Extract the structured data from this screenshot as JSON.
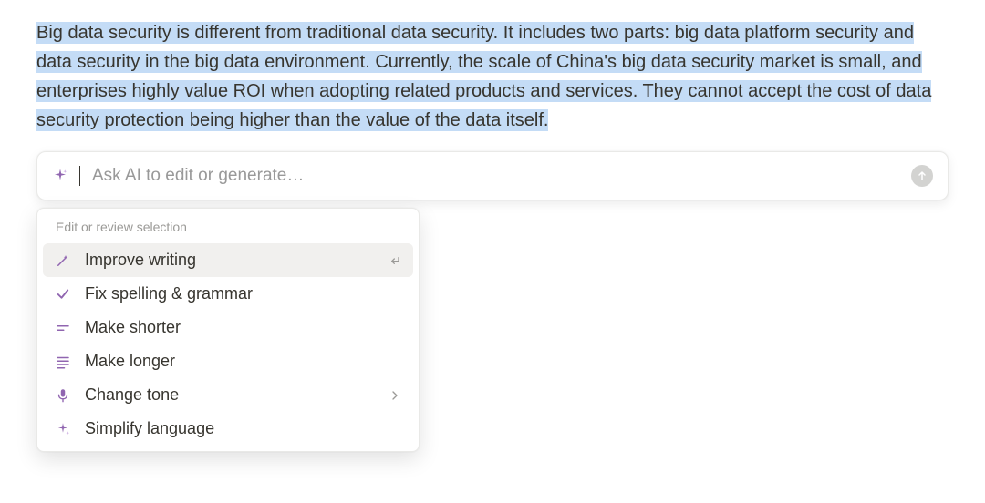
{
  "selection": {
    "text": "Big data security is different from traditional data security. It includes two parts: big data platform security and data security in the big data environment. Currently, the scale of China's big data security market is small, and enterprises highly value ROI when adopting related products and services. They cannot accept the cost of data security protection being higher than the value of the data itself."
  },
  "ai_prompt": {
    "placeholder": "Ask AI to edit or generate…",
    "value": ""
  },
  "menu": {
    "heading": "Edit or review selection",
    "items": [
      {
        "label": "Improve writing",
        "highlighted": true,
        "trailing": "enter"
      },
      {
        "label": "Fix spelling & grammar"
      },
      {
        "label": "Make shorter"
      },
      {
        "label": "Make longer"
      },
      {
        "label": "Change tone",
        "trailing": "submenu"
      },
      {
        "label": "Simplify language"
      }
    ]
  },
  "colors": {
    "highlight_bg": "#c4dcf6",
    "icon_purple": "#9065b0",
    "text_primary": "#37352f",
    "text_muted": "#9b9a97"
  }
}
